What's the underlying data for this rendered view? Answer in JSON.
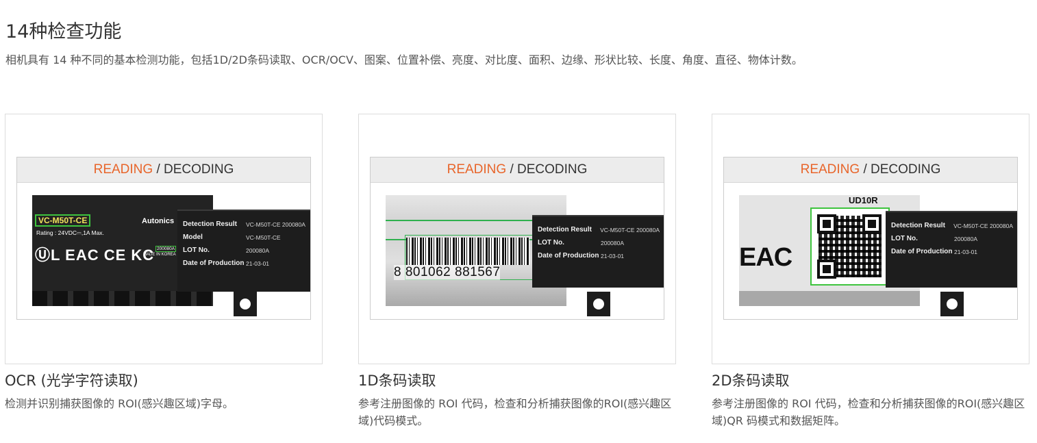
{
  "header": {
    "title": "14种检查功能",
    "description": "相机具有 14 种不同的基本检测功能，包括1D/2D条码读取、OCR/OCV、图案、位置补偿、亮度、对比度、面积、边缘、形状比较、长度、角度、直径、物体计数。"
  },
  "cards": [
    {
      "title": "OCR (光学字符读取)",
      "description": "检测并识别捕获图像的 ROI(感兴趣区域)字母。",
      "image": {
        "heading_highlight": "READING",
        "heading_rest": " / DECODING",
        "label": {
          "model": "VC-M50T-CE",
          "brand": "Autonics",
          "rating": "Rating : 24VDC⎓,1A Max.",
          "marks": "ⓊL EAC CE KC",
          "lot": "200080A",
          "made_in": "MADE IN KOREA"
        },
        "result": [
          {
            "key": "Detection Result",
            "value": "VC-M50T-CE 200080A"
          },
          {
            "key": "Model",
            "value": "VC-M50T-CE"
          },
          {
            "key": "LOT No.",
            "value": "200080A"
          },
          {
            "key": "Date of Production",
            "value": "21-03-01"
          }
        ]
      }
    },
    {
      "title": "1D条码读取",
      "description": "参考注册图像的 ROI 代码，检查和分析捕获图像的ROI(感兴趣区域)代码模式。",
      "image": {
        "heading_highlight": "READING",
        "heading_rest": " / DECODING",
        "barcode_digits": "8  801062 881567",
        "result": [
          {
            "key": "Detection Result",
            "value": "VC-M50T-CE 200080A"
          },
          {
            "key": "LOT No.",
            "value": "200080A"
          },
          {
            "key": "Date of Production",
            "value": "21-03-01"
          }
        ]
      }
    },
    {
      "title": "2D条码读取",
      "description": "参考注册图像的 ROI 代码，检查和分析捕获图像的ROI(感兴趣区域)QR 码模式和数据矩阵。",
      "image": {
        "heading_highlight": "READING",
        "heading_rest": " / DECODING",
        "code_label": "UD10R",
        "marks": "EAC",
        "result": [
          {
            "key": "Detection Result",
            "value": "VC-M50T-CE 200080A"
          },
          {
            "key": "LOT No.",
            "value": "200080A"
          },
          {
            "key": "Date of Production",
            "value": "21-03-01"
          }
        ]
      }
    }
  ]
}
